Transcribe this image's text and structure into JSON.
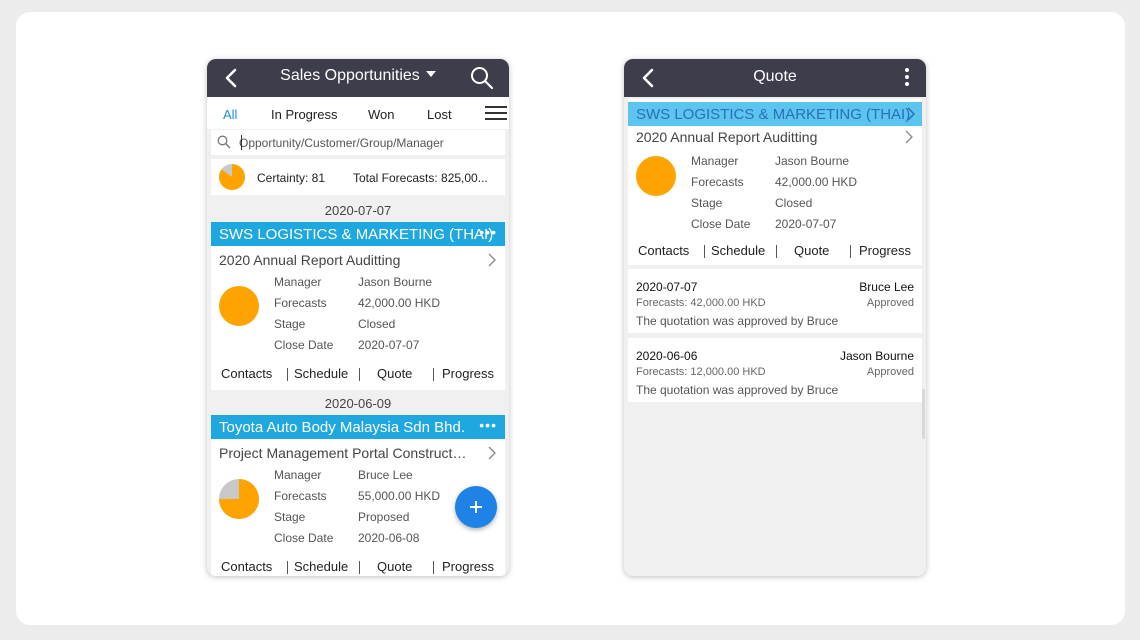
{
  "left": {
    "title": "Sales Opportunities",
    "tabs": [
      "All",
      "In Progress",
      "Won",
      "Lost"
    ],
    "search_placeholder": "Opportunity/Customer/Group/Manager",
    "certainty": "Certainty: 81",
    "total_forecasts": "Total Forecasts: 825,00...",
    "groups": [
      {
        "date": "2020-07-07",
        "customer": "SWS LOGISTICS & MARKETING (THAI)",
        "opportunity": "2020 Annual Report Auditting",
        "labels": [
          "Manager",
          "Forecasts",
          "Stage",
          "Close Date"
        ],
        "values": [
          "Jason  Bourne",
          "42,000.00 HKD",
          "Closed",
          "2020-07-07"
        ],
        "certainty_fraction": 1.0,
        "actions": [
          "Contacts",
          "Schedule",
          "Quote",
          "Progress"
        ]
      },
      {
        "date": "2020-06-09",
        "customer": "Toyota Auto Body Malaysia Sdn Bhd.",
        "opportunity": "Project Management Portal Construction",
        "labels": [
          "Manager",
          "Forecasts",
          "Stage",
          "Close Date"
        ],
        "values": [
          "Bruce  Lee",
          "55,000.00 HKD",
          "Proposed",
          "2020-06-08"
        ],
        "certainty_fraction": 0.75,
        "actions": [
          "Contacts",
          "Schedule",
          "Quote",
          "Progress"
        ]
      }
    ]
  },
  "right": {
    "title": "Quote",
    "customer": "SWS LOGISTICS & MARKETING (THAI)",
    "opportunity": "2020 Annual Report Auditting",
    "labels": [
      "Manager",
      "Forecasts",
      "Stage",
      "Close Date"
    ],
    "values": [
      "Jason  Bourne",
      "42,000.00 HKD",
      "Closed",
      "2020-07-07"
    ],
    "actions": [
      "Contacts",
      "Schedule",
      "Quote",
      "Progress"
    ],
    "history": [
      {
        "date": "2020-07-07",
        "user": "Bruce  Lee",
        "forecast": "Forecasts: 42,000.00 HKD",
        "status": "Approved",
        "note": "The quotation was approved by Bruce"
      },
      {
        "date": "2020-06-06",
        "user": "Jason  Bourne",
        "forecast": "Forecasts: 12,000.00 HKD",
        "status": "Approved",
        "note": "The quotation was approved by Bruce"
      }
    ]
  },
  "colors": {
    "topbar": "#3d3d4c",
    "accent_blue": "#1ea8df",
    "light_blue": "#5bc4ef",
    "pie_orange": "#ffa300",
    "pie_grey": "#c8c8c8",
    "fab_blue": "#1e82e6"
  },
  "icons": [
    "back-icon",
    "caret-down-icon",
    "search-icon",
    "menu-icon",
    "more-icon",
    "chevron-right-icon",
    "plus-icon",
    "kebab-icon"
  ]
}
